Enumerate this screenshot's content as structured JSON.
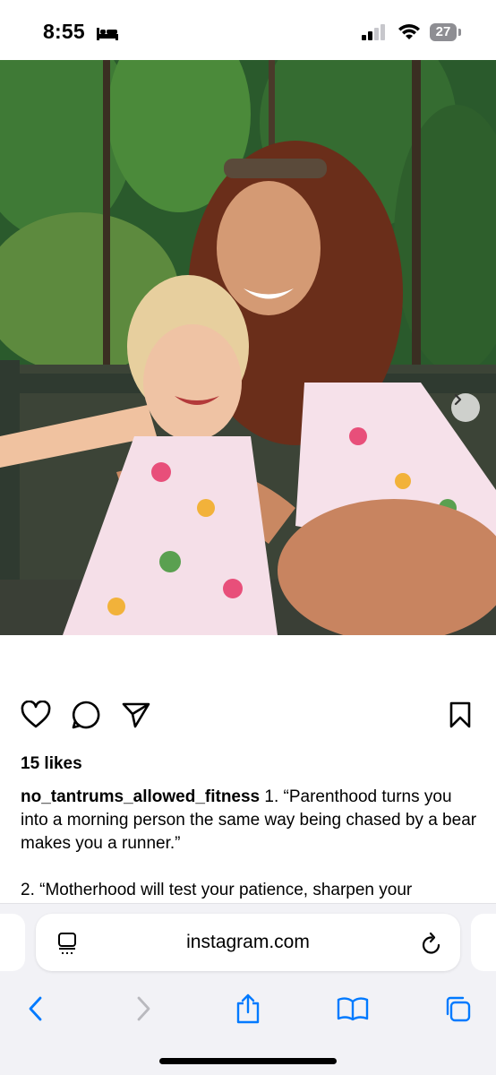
{
  "status_bar": {
    "time": "8:55",
    "sleep_icon": "bed-icon",
    "battery": "27"
  },
  "post": {
    "photo_alt_icon": "photo-woman-and-child",
    "carousel_next_icon": "chevron-right-icon",
    "likes": "15 likes",
    "username": "no_tantrums_allowed_fitness",
    "caption_line1": " 1. “Parenthood turns you into a morning person the same way being chased by a bear makes you a runner.”",
    "caption_line2": "2. “Motherhood will test your patience, sharpen your"
  },
  "browser": {
    "url": "instagram.com",
    "accent": "#007aff"
  }
}
